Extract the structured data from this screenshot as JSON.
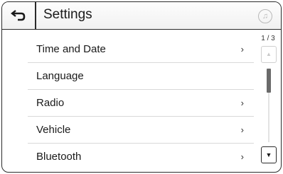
{
  "header": {
    "back_icon": "back-arrow-icon",
    "title": "Settings",
    "audio_icon": "music-note-icon",
    "audio_symbol": "♫"
  },
  "list": {
    "items": [
      {
        "label": "Time and Date",
        "has_submenu": true,
        "chevron": "›"
      },
      {
        "label": "Language",
        "has_submenu": false,
        "chevron": ""
      },
      {
        "label": "Radio",
        "has_submenu": true,
        "chevron": "›"
      },
      {
        "label": "Vehicle",
        "has_submenu": true,
        "chevron": "›"
      },
      {
        "label": "Bluetooth",
        "has_submenu": true,
        "chevron": "›"
      }
    ]
  },
  "scrollbar": {
    "page_indicator": "1 / 3",
    "current_page": 1,
    "total_pages": 3,
    "up_symbol": "▲",
    "down_symbol": "▼",
    "up_enabled": false,
    "down_enabled": true
  }
}
